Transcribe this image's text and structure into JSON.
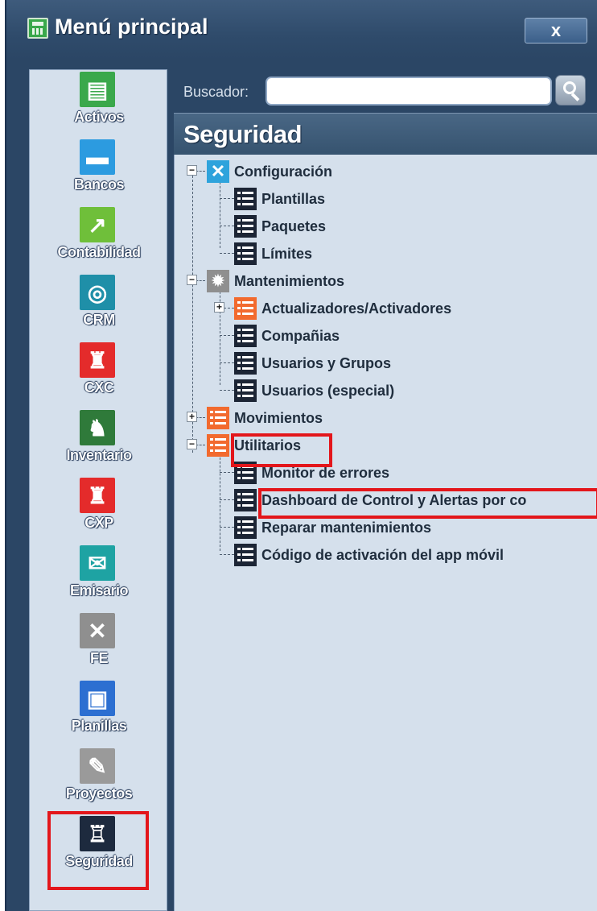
{
  "window": {
    "title": "Menú principal",
    "close_label": "x"
  },
  "sidebar": {
    "modules": [
      {
        "label": "Activos",
        "icon": "cash-register-icon",
        "color": "#3aa84b"
      },
      {
        "label": "Bancos",
        "icon": "briefcase-icon",
        "color": "#2c9be0"
      },
      {
        "label": "Contabilidad",
        "icon": "chart-icon",
        "color": "#6fbf3a"
      },
      {
        "label": "CRM",
        "icon": "globe-icon",
        "color": "#1f8fa8"
      },
      {
        "label": "CXC",
        "icon": "person-money-icon",
        "color": "#e42b2b"
      },
      {
        "label": "Inventario",
        "icon": "person-board-icon",
        "color": "#2f7a3a"
      },
      {
        "label": "CXP",
        "icon": "person-payment-icon",
        "color": "#e42b2b"
      },
      {
        "label": "Emisario",
        "icon": "envelope-icon",
        "color": "#1ea3a3"
      },
      {
        "label": "FE",
        "icon": "tools-icon",
        "color": "#8f8f8f"
      },
      {
        "label": "Planillas",
        "icon": "document-icon",
        "color": "#2c6fd1"
      },
      {
        "label": "Proyectos",
        "icon": "pencil-ruler-icon",
        "color": "#9a9a9a"
      },
      {
        "label": "Seguridad",
        "icon": "castle-icon",
        "color": "#1d2a3e"
      }
    ]
  },
  "search": {
    "label": "Buscador:",
    "value": "",
    "placeholder": ""
  },
  "section": {
    "title": "Seguridad"
  },
  "tree": {
    "configuracion": "Configuración",
    "plantillas": "Plantillas",
    "paquetes": "Paquetes",
    "limites": "Límites",
    "mantenimientos": "Mantenimientos",
    "actualizadores": "Actualizadores/Activadores",
    "companias": "Compañias",
    "usuarios_grupos": "Usuarios y Grupos",
    "usuarios_especial": "Usuarios (especial)",
    "movimientos": "Movimientos",
    "utilitarios": "Utilitarios",
    "monitor_errores": "Monitor de errores",
    "dashboard": "Dashboard de Control y Alertas por co",
    "reparar": "Reparar mantenimientos",
    "codigo_activacion": "Código de activación del app móvil"
  },
  "colors": {
    "highlight": "#e3161b",
    "window_bg": "#2b4665",
    "panel_bg": "#d5e0ec"
  }
}
